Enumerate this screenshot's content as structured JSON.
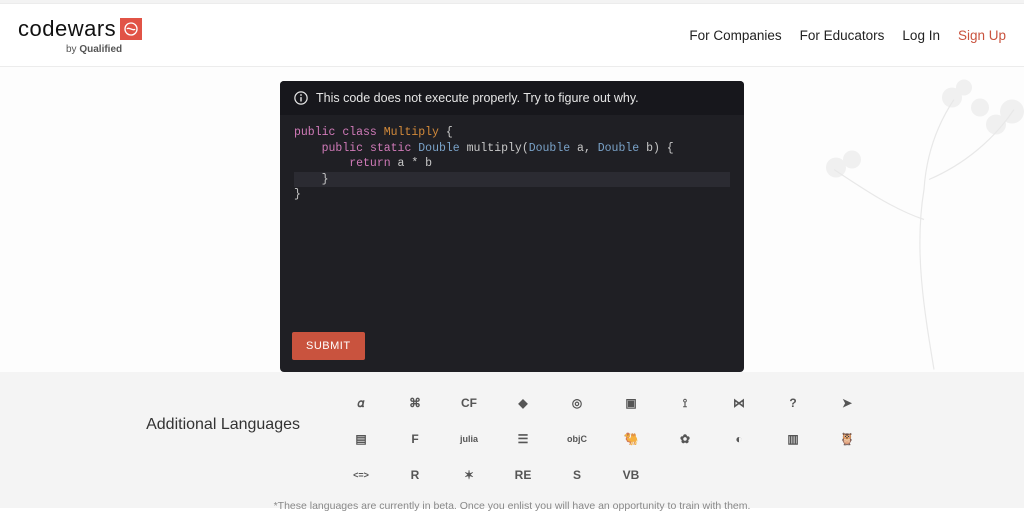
{
  "brand": {
    "name": "codewars",
    "subline_prefix": "by ",
    "subline_bold": "Qualified"
  },
  "nav": {
    "for_companies": "For Companies",
    "for_educators": "For Educators",
    "log_in": "Log In",
    "sign_up": "Sign Up"
  },
  "editor": {
    "instruction": "This code does not execute properly. Try to figure out why.",
    "code": {
      "l1_kw1": "public",
      "l1_kw2": "class",
      "l1_cls": "Multiply",
      "l1_brace": " {",
      "l2_kw1": "public",
      "l2_kw2": "static",
      "l2_type": "Double",
      "l2_fn": "multiply",
      "l2_sig_open": "(",
      "l2_type2": "Double",
      "l2_arg1": " a, ",
      "l2_type3": "Double",
      "l2_arg2": " b) {",
      "l3_kw": "return",
      "l3_expr": " a * b",
      "l4_brace": "}",
      "l5_brace": "}"
    },
    "submit": "SUBMIT"
  },
  "languages": {
    "title": "Additional Languages",
    "note": "*These languages are currently in beta. Once you enlist you will have an opportunity to train with them.",
    "items": [
      "agda-icon",
      "bf-icon",
      "cf-icon",
      "crystal-icon",
      "cobol-icon",
      "elixir-icon",
      "elm-icon",
      "erlang-icon",
      "factor-icon",
      "forth-icon",
      "fortran-icon",
      "fsharp-icon",
      "julia-icon",
      "groovy-icon",
      "objc-icon",
      "ocaml-icon",
      "pascal-icon",
      "perl-icon",
      "powershell-icon",
      "prolog-icon",
      "purescript-icon",
      "r-icon",
      "racket-icon",
      "reason-icon",
      "solidity-icon",
      "vb-icon"
    ],
    "glyphs": {
      "agda-icon": "𝛼",
      "bf-icon": "⌘",
      "cf-icon": "CF",
      "crystal-icon": "◆",
      "cobol-icon": "◎",
      "elixir-icon": "▣",
      "elm-icon": "⟟",
      "erlang-icon": "⋈",
      "factor-icon": "?",
      "forth-icon": "➤",
      "fortran-icon": "▤",
      "fsharp-icon": "F",
      "julia-icon": "julia",
      "groovy-icon": "☰",
      "objc-icon": "objC",
      "ocaml-icon": "🐫",
      "pascal-icon": "✿",
      "perl-icon": "◐",
      "powershell-icon": "▥",
      "prolog-icon": "🦉",
      "purescript-icon": "<=>",
      "r-icon": "R",
      "racket-icon": "✶",
      "reason-icon": "RE",
      "solidity-icon": "S",
      "vb-icon": "VB"
    }
  }
}
